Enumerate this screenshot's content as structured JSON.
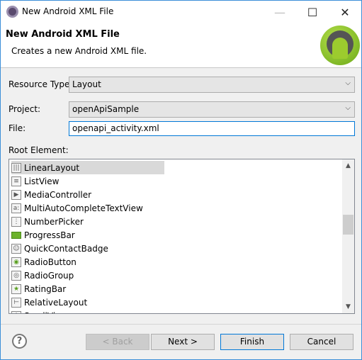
{
  "window": {
    "title": "New Android XML File",
    "icon": "eclipse-gear-icon"
  },
  "header": {
    "title": "New Android XML File",
    "description": "Creates a new Android XML file.",
    "logo": "android-logo"
  },
  "form": {
    "resource_type": {
      "label": "Resource Type:",
      "value": "Layout"
    },
    "project": {
      "label": "Project:",
      "value": "openApiSample"
    },
    "file": {
      "label": "File:",
      "value": "openapi_activity.xml"
    },
    "root_element": {
      "label": "Root Element:",
      "items": [
        {
          "label": "LinearLayout",
          "icon": "linear-layout-icon",
          "glyph": "|||",
          "selected": true
        },
        {
          "label": "ListView",
          "icon": "list-view-icon",
          "glyph": "≡"
        },
        {
          "label": "MediaController",
          "icon": "media-controller-icon",
          "glyph": "▶"
        },
        {
          "label": "MultiAutoCompleteTextView",
          "icon": "text-view-icon",
          "glyph": "a:"
        },
        {
          "label": "NumberPicker",
          "icon": "number-picker-icon",
          "glyph": "⋮"
        },
        {
          "label": "ProgressBar",
          "icon": "progress-bar-icon",
          "glyph": ""
        },
        {
          "label": "QuickContactBadge",
          "icon": "contact-badge-icon",
          "glyph": "☺"
        },
        {
          "label": "RadioButton",
          "icon": "radio-button-icon",
          "glyph": "◉"
        },
        {
          "label": "RadioGroup",
          "icon": "radio-group-icon",
          "glyph": "◎"
        },
        {
          "label": "RatingBar",
          "icon": "star-icon",
          "glyph": "★"
        },
        {
          "label": "RelativeLayout",
          "icon": "relative-layout-icon",
          "glyph": "⊢"
        },
        {
          "label": "ScrollView",
          "icon": "scroll-view-icon",
          "glyph": "↕"
        }
      ]
    }
  },
  "buttons": {
    "back": "< Back",
    "next": "Next >",
    "finish": "Finish",
    "cancel": "Cancel",
    "help": "?"
  }
}
